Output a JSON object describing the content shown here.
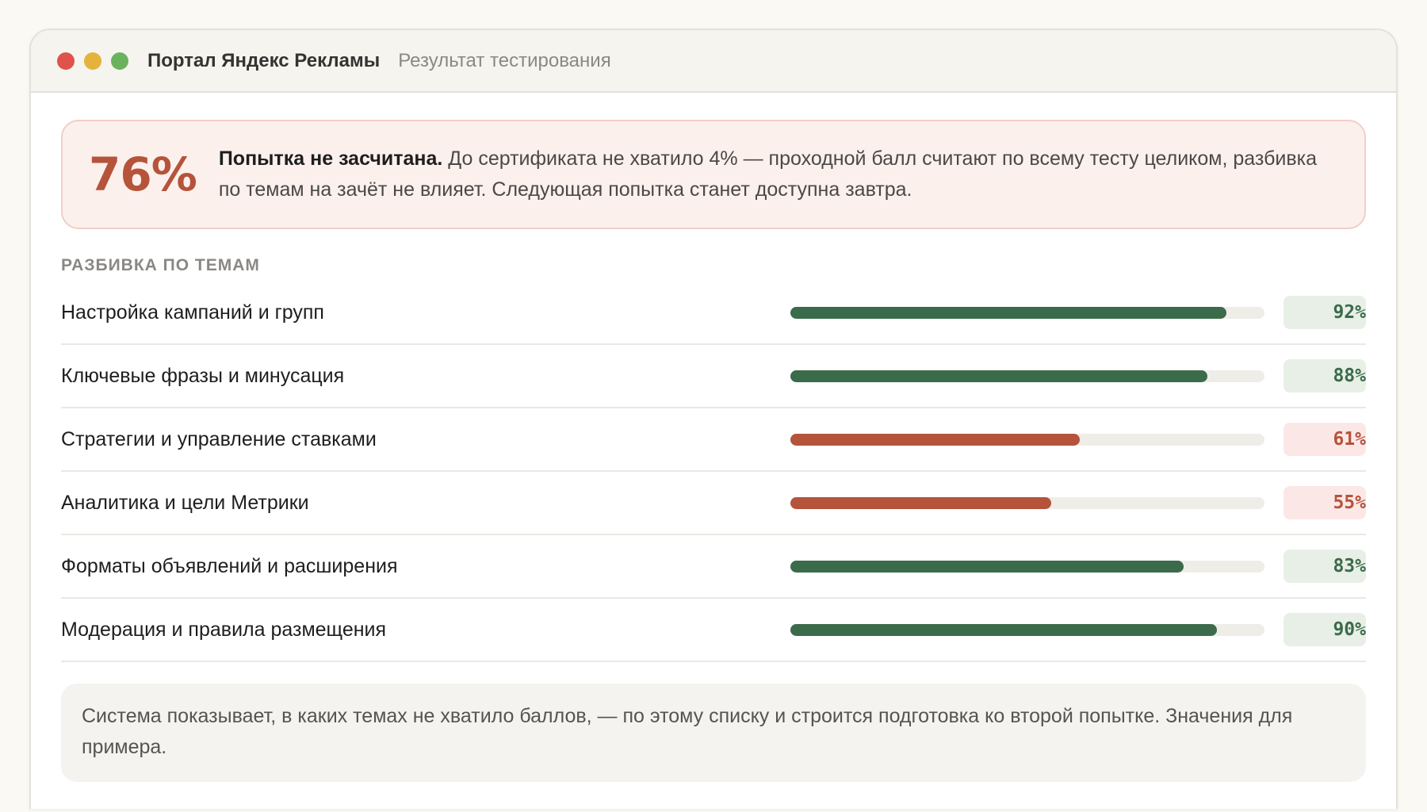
{
  "window": {
    "app_title": "Портал Яндекс Рекламы",
    "page_subtitle": "Результат тестирования"
  },
  "result": {
    "score": "76%",
    "status_bold": "Попытка не засчитана.",
    "status_text": " До сертификата не хватило 4% — проходной балл считают по всему тесту целиком, разбивка по темам на зачёт не влияет. Следующая попытка станет доступна завтра."
  },
  "breakdown": {
    "section_title": "РАЗБИВКА ПО ТЕМАМ",
    "topics": [
      {
        "name": "Настройка кампаний и групп",
        "percent": 92,
        "label": "92%",
        "status": "pass"
      },
      {
        "name": "Ключевые фразы и минусация",
        "percent": 88,
        "label": "88%",
        "status": "pass"
      },
      {
        "name": "Стратегии и управление ставками",
        "percent": 61,
        "label": "61%",
        "status": "fail"
      },
      {
        "name": "Аналитика и цели Метрики",
        "percent": 55,
        "label": "55%",
        "status": "fail"
      },
      {
        "name": "Форматы объявлений и расширения",
        "percent": 83,
        "label": "83%",
        "status": "pass"
      },
      {
        "name": "Модерация и правила размещения",
        "percent": 90,
        "label": "90%",
        "status": "pass"
      }
    ]
  },
  "note": {
    "text": "Система показывает, в каких темах не хватило баллов, — по этому списку и строится подготовка ко второй попытке. Значения для примера."
  },
  "colors": {
    "pass": "#3b6b4a",
    "fail": "#b5533b",
    "window_close": "#e0534c",
    "window_minimize": "#e3b33b",
    "window_maximize": "#6bb25e"
  }
}
